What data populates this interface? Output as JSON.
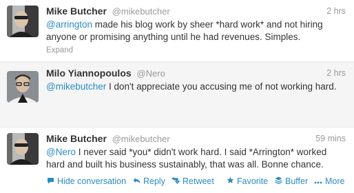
{
  "tweets": [
    {
      "name": "Mike Butcher",
      "handle": "@mikebutcher",
      "time": "2 hrs",
      "mention": "@arrington",
      "text": " made his blog work by sheer *hard work* and not hiring anyone or promising anything until he had revenues. Simples.",
      "expand": "Expand"
    },
    {
      "name": "Milo Yiannopoulos",
      "handle": "@Nero",
      "time": "2 hrs",
      "mention": "@mikebutcher",
      "text": " I don't appreciate you accusing me of not working hard."
    },
    {
      "name": "Mike Butcher",
      "handle": "@mikebutcher",
      "time": "59 mins",
      "mention": "@Nero",
      "text": " I never said *you* didn't work hard. I said *Arrington* worked hard and built his business sustainably, that was all. Bonne chance."
    }
  ],
  "actions": {
    "hide": "Hide conversation",
    "reply": "Reply",
    "retweet": "Retweet",
    "favorite": "Favorite",
    "buffer": "Buffer",
    "more": "More"
  },
  "icons": {
    "conversation": "speech-bubble-icon",
    "reply": "reply-arrow-icon",
    "retweet": "retweet-icon",
    "favorite": "star-icon",
    "buffer": "buffer-stack-icon",
    "more": "ellipsis-icon"
  },
  "colors": {
    "link": "#2a8cc1",
    "muted": "#999999",
    "text": "#333333",
    "highlight_bg": "#f5f5f5"
  }
}
